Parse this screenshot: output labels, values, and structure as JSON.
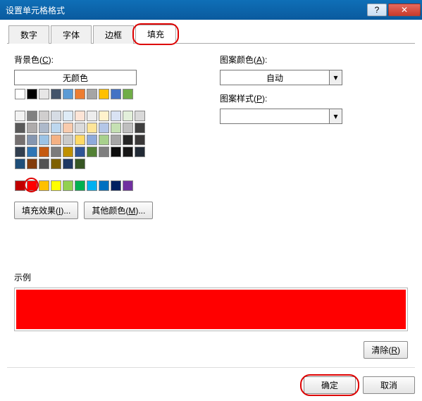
{
  "window": {
    "title": "设置单元格格式"
  },
  "tabs": {
    "items": [
      {
        "label": "数字"
      },
      {
        "label": "字体"
      },
      {
        "label": "边框"
      },
      {
        "label": "填充"
      }
    ],
    "active_index": 3
  },
  "left_panel": {
    "bg_label_pre": "背景色(",
    "bg_hotkey": "C",
    "bg_label_post": "):",
    "no_color": "无颜色",
    "row_top": [
      "#ffffff",
      "#000000",
      "#e7e6e6",
      "#44546a",
      "#5b9bd5",
      "#ed7d31",
      "#a5a5a5",
      "#ffc000",
      "#4472c4",
      "#70ad47"
    ],
    "grid": [
      [
        "#f2f2f2",
        "#808080",
        "#d0cece",
        "#d6dce4",
        "#deebf6",
        "#fce4d6",
        "#ededed",
        "#fff2cc",
        "#d9e2f3",
        "#e2efda"
      ],
      [
        "#d9d9d9",
        "#595959",
        "#aeabab",
        "#adb9ca",
        "#bdd7ee",
        "#f8cbad",
        "#dbdbdb",
        "#fee599",
        "#b4c6e7",
        "#c5e0b3"
      ],
      [
        "#bfbfbf",
        "#3f3f3f",
        "#757070",
        "#8596b0",
        "#9cc3e5",
        "#f4b183",
        "#c9c9c9",
        "#ffd965",
        "#8eaadb",
        "#a8d08d"
      ],
      [
        "#a5a5a5",
        "#262626",
        "#3a3838",
        "#323f4f",
        "#2e75b5",
        "#c55a11",
        "#7b7b7b",
        "#bf9000",
        "#2f5496",
        "#538135"
      ],
      [
        "#7f7f7f",
        "#0c0c0c",
        "#171616",
        "#222a35",
        "#1e4e79",
        "#833c0b",
        "#525252",
        "#7f6000",
        "#1f3864",
        "#375623"
      ]
    ],
    "row_std": [
      "#c00000",
      "#ff0000",
      "#ffc000",
      "#ffff00",
      "#92d050",
      "#00b050",
      "#00b0f0",
      "#0070c0",
      "#002060",
      "#7030a0"
    ],
    "selected_color": "#ff0000",
    "btn_fill_effects_pre": "填充效果(",
    "btn_fill_effects_hot": "I",
    "btn_fill_effects_post": ")...",
    "btn_more_colors_pre": "其他颜色(",
    "btn_more_colors_hot": "M",
    "btn_more_colors_post": ")..."
  },
  "right_panel": {
    "pattern_color_label_pre": "图案颜色(",
    "pattern_color_hot": "A",
    "pattern_color_label_post": "):",
    "pattern_color_value": "自动",
    "pattern_style_label_pre": "图案样式(",
    "pattern_style_hot": "P",
    "pattern_style_label_post": "):",
    "pattern_style_value": ""
  },
  "sample": {
    "label": "示例",
    "color": "#ff0000"
  },
  "buttons": {
    "clear_pre": "清除(",
    "clear_hot": "R",
    "clear_post": ")",
    "ok": "确定",
    "cancel": "取消"
  }
}
